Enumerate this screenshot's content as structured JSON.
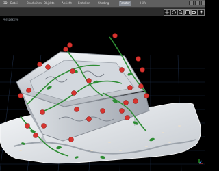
{
  "window": {
    "title": "3D",
    "menu": [
      "Datei",
      "Bearbeiten",
      "Objekte",
      "Ansicht",
      "Erstellen",
      "Shading",
      "Fenster",
      "Hilfe"
    ],
    "active_menu": "Fenster"
  },
  "toolbar": {
    "buttons": [
      "move-icon",
      "rotate-icon",
      "zoom-icon",
      "render-icon",
      "camera-icon",
      "light-icon",
      "frame-icon"
    ]
  },
  "viewport": {
    "label": "Perspektive",
    "background": "#000000",
    "grid_color": "#1f2f4a",
    "ground_color": "#dfe3e7",
    "coffin_color": "#c8ccd2",
    "rose_color": "#d7342f",
    "leaf_color": "#2e8d34",
    "axis": [
      "x",
      "y",
      "z"
    ]
  }
}
